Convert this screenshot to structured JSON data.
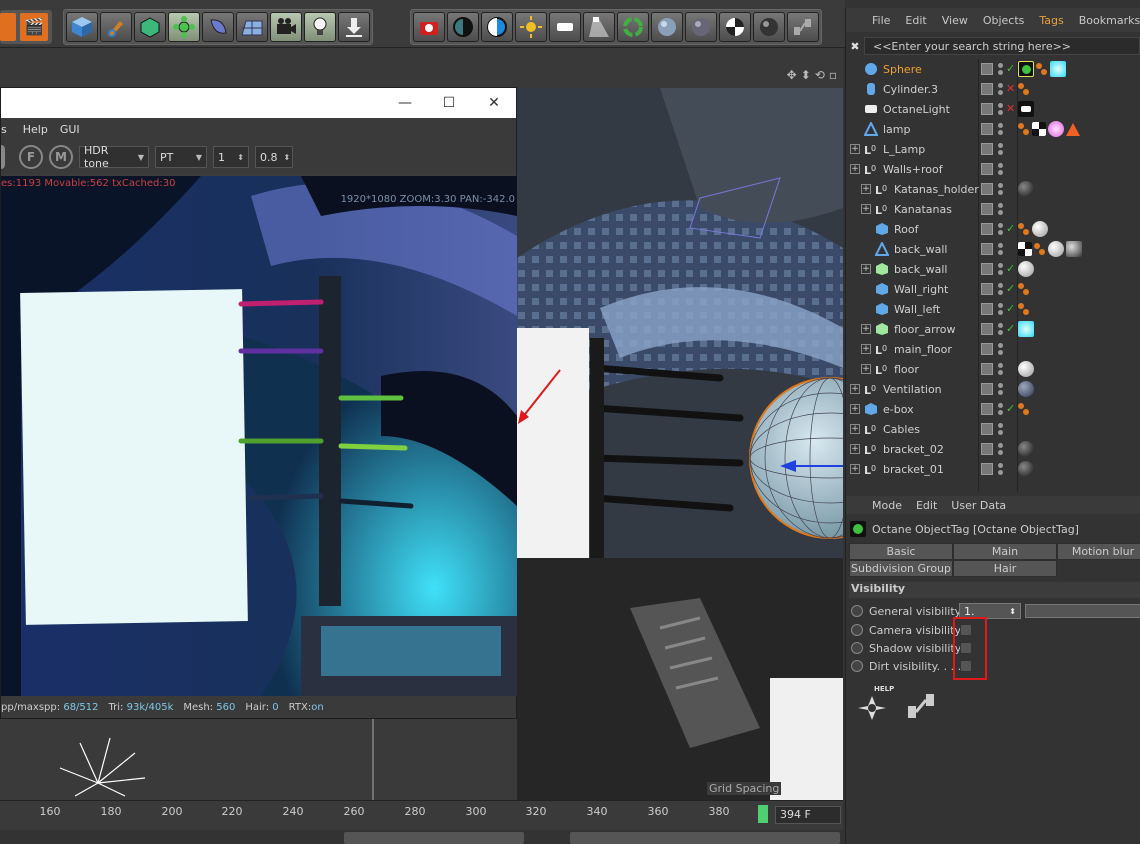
{
  "toolbar": {
    "left_buttons": [
      "cube-icon",
      "pen-icon",
      "cube-select-icon",
      "gear-flower-icon",
      "deformer-icon",
      "floor-grid-icon",
      "camera-icon",
      "light-bulb-icon",
      "download-arrow-icon"
    ],
    "right_buttons": [
      "render-camera-icon",
      "half-circle-dark-icon",
      "half-circle-blue-icon",
      "sun-icon",
      "area-light-icon",
      "spot-light-icon",
      "recycle-icon",
      "sphere-material-icon",
      "glass-sphere-icon",
      "checker-sphere-icon",
      "chrome-sphere-icon",
      "node-icon"
    ]
  },
  "render_window": {
    "menu": [
      "s",
      "Help",
      "GUI"
    ],
    "circle_buttons": [
      "F",
      "M"
    ],
    "tone_select": "HDR tone",
    "pt_select": "PT",
    "value_1": "1",
    "value_2": "0.8",
    "overlay_left": "es:1193 Movable:562 txCached:30",
    "overlay_right": "1920*1080 ZOOM:3.30 PAN:-342.0",
    "status": {
      "spp_label": "pp/maxspp:",
      "spp_value": "68/512",
      "tri_label": "Tri:",
      "tri_value": "93k/405k",
      "mesh_label": "Mesh:",
      "mesh_value": "560",
      "hair_label": "Hair:",
      "hair_value": "0",
      "rtx_label": "RTX:",
      "rtx_value": "on"
    }
  },
  "viewport": {
    "grid_spacing": "Grid Spacing"
  },
  "timeline": {
    "ticks": [
      "160",
      "180",
      "200",
      "220",
      "240",
      "260",
      "280",
      "300",
      "320",
      "340",
      "360",
      "380"
    ],
    "frame": "394 F"
  },
  "object_manager": {
    "menu": [
      "File",
      "Edit",
      "View",
      "Objects",
      "Tags",
      "Bookmarks"
    ],
    "active_menu": "Tags",
    "search_placeholder": "<<Enter your search string here>>",
    "objects": [
      {
        "name": "Sphere",
        "depth": 1,
        "expandable": false,
        "icon": "sphere",
        "selected": true,
        "flag": "check",
        "tags": [
          "green-octane-tag",
          "dots",
          "cyan-material"
        ]
      },
      {
        "name": "Cylinder.3",
        "depth": 1,
        "expandable": false,
        "icon": "cylinder",
        "flag": "x",
        "tags": [
          "dots"
        ]
      },
      {
        "name": "OctaneLight",
        "depth": 1,
        "expandable": false,
        "icon": "light",
        "flag": "x",
        "tags": [
          "white-light-tag"
        ]
      },
      {
        "name": "lamp",
        "depth": 1,
        "expandable": false,
        "icon": "polygon",
        "tags": [
          "dots",
          "checker-tag",
          "pink-material",
          "warning-tag"
        ]
      },
      {
        "name": "L_Lamp",
        "depth": 1,
        "expandable": true,
        "icon": "null",
        "tags": []
      },
      {
        "name": "Walls+roof",
        "depth": 1,
        "expandable": true,
        "icon": "null",
        "tags": []
      },
      {
        "name": "Katanas_holder",
        "depth": 2,
        "expandable": true,
        "icon": "null",
        "tags": [
          "black-material"
        ]
      },
      {
        "name": "Kanatanas",
        "depth": 2,
        "expandable": true,
        "icon": "null",
        "tags": []
      },
      {
        "name": "Roof",
        "depth": 2,
        "expandable": false,
        "icon": "cube",
        "flag": "check",
        "tags": [
          "dots",
          "white-material"
        ]
      },
      {
        "name": "back_wall",
        "depth": 2,
        "expandable": false,
        "icon": "polygon",
        "tags": [
          "checker-tag",
          "dots",
          "white-material",
          "rough-material"
        ]
      },
      {
        "name": "back_wall",
        "depth": 2,
        "expandable": true,
        "icon": "green-cube",
        "flag": "check-red",
        "tags": [
          "white-material"
        ]
      },
      {
        "name": "Wall_right",
        "depth": 2,
        "expandable": false,
        "icon": "cube",
        "flag": "check",
        "tags": [
          "dots"
        ]
      },
      {
        "name": "Wall_left",
        "depth": 2,
        "expandable": false,
        "icon": "cube",
        "flag": "check",
        "tags": [
          "dots"
        ]
      },
      {
        "name": "floor_arrow",
        "depth": 2,
        "expandable": true,
        "icon": "green-cube",
        "flag": "check",
        "tags": [
          "cyan-material"
        ]
      },
      {
        "name": "main_floor",
        "depth": 2,
        "expandable": true,
        "icon": "null",
        "tags": []
      },
      {
        "name": "floor",
        "depth": 2,
        "expandable": true,
        "icon": "null",
        "tags": [
          "white-material"
        ]
      },
      {
        "name": "Ventilation",
        "depth": 1,
        "expandable": true,
        "icon": "null",
        "tags": [
          "blue-sphere-material"
        ]
      },
      {
        "name": "e-box",
        "depth": 1,
        "expandable": true,
        "icon": "cube",
        "flag": "check",
        "tags": [
          "dots"
        ]
      },
      {
        "name": "Cables",
        "depth": 1,
        "expandable": true,
        "icon": "null",
        "tags": []
      },
      {
        "name": "bracket_02",
        "depth": 1,
        "expandable": true,
        "icon": "null",
        "tags": [
          "black-material"
        ]
      },
      {
        "name": "bracket_01",
        "depth": 1,
        "expandable": true,
        "icon": "null",
        "tags": [
          "black-material"
        ]
      }
    ]
  },
  "attribute_manager": {
    "menu": [
      "Mode",
      "Edit",
      "User Data"
    ],
    "title": "Octane ObjectTag [Octane ObjectTag]",
    "tabs_row1": [
      "Basic",
      "Main",
      "Motion blur"
    ],
    "tabs_row2": [
      "Subdivision Group",
      "Hair"
    ],
    "section": "Visibility",
    "props": [
      {
        "label": "General visibility",
        "value": "1."
      },
      {
        "label": "Camera visibility",
        "checked": false
      },
      {
        "label": "Shadow visibility",
        "checked": false
      },
      {
        "label": "Dirt visibility. . . .",
        "checked": false
      }
    ],
    "help_label": "HELP"
  }
}
